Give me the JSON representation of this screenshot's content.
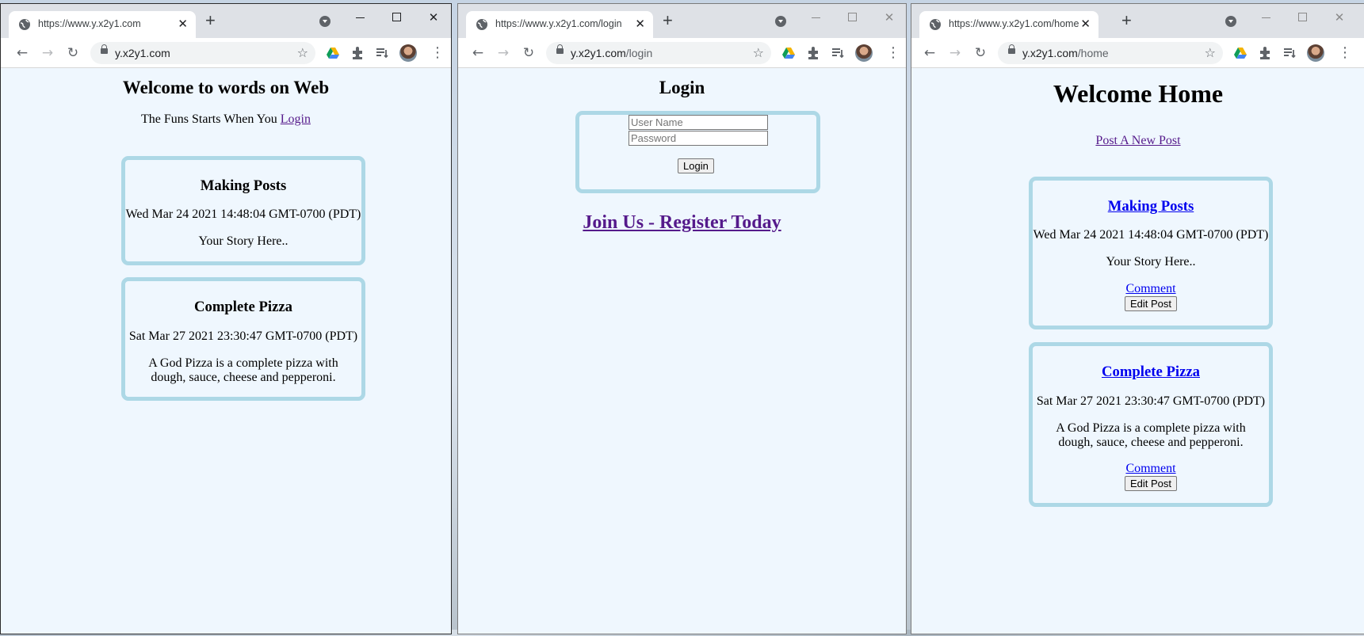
{
  "windows": [
    {
      "tab_title": "https://www.y.x2y1.com",
      "address": {
        "host": "y.x2y1.com",
        "path": ""
      },
      "page": {
        "heading": "Welcome to words on Web",
        "tagline_text": "The Funs Starts When You",
        "tagline_link": "Login",
        "posts": [
          {
            "title": "Making Posts",
            "date": "Wed Mar 24 2021 14:48:04 GMT-0700 (PDT)",
            "body": "Your Story Here.."
          },
          {
            "title": "Complete Pizza",
            "date": "Sat Mar 27 2021 23:30:47 GMT-0700 (PDT)",
            "body": "A God Pizza is a complete pizza with dough, sauce, cheese and pepperoni."
          }
        ]
      }
    },
    {
      "tab_title": "https://www.y.x2y1.com/login",
      "address": {
        "host": "y.x2y1.com",
        "path": "/login"
      },
      "page": {
        "heading": "Login",
        "username_placeholder": "User Name",
        "password_placeholder": "Password",
        "login_button": "Login",
        "register_link": "Join Us - Register Today"
      }
    },
    {
      "tab_title": "https://www.y.x2y1.com/home",
      "address": {
        "host": "y.x2y1.com",
        "path": "/home"
      },
      "page": {
        "heading": "Welcome Home",
        "new_post_link": "Post A New Post",
        "posts": [
          {
            "title": "Making Posts",
            "date": "Wed Mar 24 2021 14:48:04 GMT-0700 (PDT)",
            "body": "Your Story Here..",
            "comment_link": "Comment",
            "edit_button": "Edit Post"
          },
          {
            "title": "Complete Pizza",
            "date": "Sat Mar 27 2021 23:30:47 GMT-0700 (PDT)",
            "body": "A God Pizza is a complete pizza with dough, sauce, cheese and pepperoni.",
            "comment_link": "Comment",
            "edit_button": "Edit Post"
          }
        ]
      }
    }
  ],
  "browser": {
    "icons": [
      "globe-icon",
      "close-tab-icon",
      "new-tab-icon",
      "tab-search-icon",
      "minimize-icon",
      "maximize-icon",
      "close-window-icon",
      "back-icon",
      "forward-icon",
      "reload-icon",
      "lock-icon",
      "bookmark-star-icon",
      "google-drive-icon",
      "extensions-icon",
      "reading-list-icon",
      "profile-avatar",
      "menu-icon"
    ],
    "glyphs": {
      "close": "✕",
      "new_tab": "+",
      "back": "←",
      "forward": "→",
      "reload": "↻",
      "star": "☆",
      "menu": "⋮"
    }
  },
  "colors": {
    "page_bg": "#eff7fe",
    "card_border": "#add8e6",
    "visited_link": "#551a8b",
    "link": "#0000ee",
    "chrome_frame": "#dee1e6"
  }
}
